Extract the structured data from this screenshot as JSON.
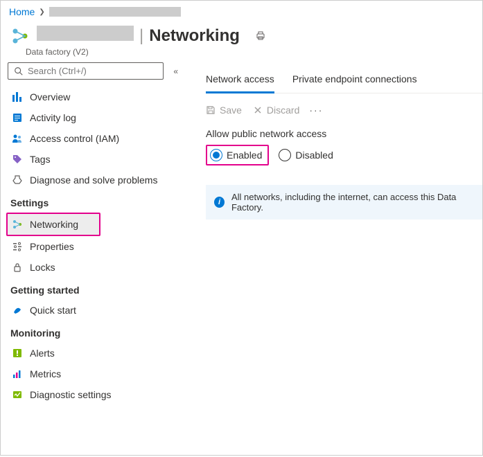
{
  "breadcrumb": {
    "home": "Home"
  },
  "header": {
    "separator": "|",
    "title": "Networking",
    "subtitle": "Data factory (V2)"
  },
  "search": {
    "placeholder": "Search (Ctrl+/)"
  },
  "nav": {
    "overview": "Overview",
    "activity_log": "Activity log",
    "access_control": "Access control (IAM)",
    "tags": "Tags",
    "diagnose": "Diagnose and solve problems",
    "settings_header": "Settings",
    "networking": "Networking",
    "properties": "Properties",
    "locks": "Locks",
    "getting_started_header": "Getting started",
    "quick_start": "Quick start",
    "monitoring_header": "Monitoring",
    "alerts": "Alerts",
    "metrics": "Metrics",
    "diagnostic_settings": "Diagnostic settings"
  },
  "tabs": {
    "network_access": "Network access",
    "private_endpoint": "Private endpoint connections"
  },
  "toolbar": {
    "save": "Save",
    "discard": "Discard"
  },
  "section": {
    "allow_public": "Allow public network access",
    "enabled": "Enabled",
    "disabled": "Disabled"
  },
  "info": {
    "text": "All networks, including the internet, can access this Data Factory."
  }
}
